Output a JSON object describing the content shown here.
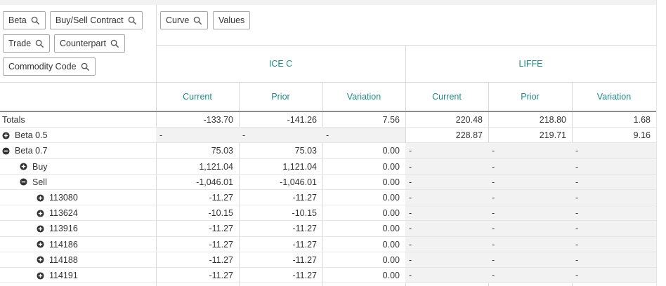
{
  "dimension_pills": [
    {
      "label": "Beta",
      "icon": "search-icon"
    },
    {
      "label": "Buy/Sell Contract",
      "icon": "search-icon"
    },
    {
      "label": "Trade",
      "icon": "search-icon"
    },
    {
      "label": "Counterpart",
      "icon": "search-icon"
    },
    {
      "label": "Commodity Code",
      "icon": "search-icon"
    }
  ],
  "column_pills": [
    {
      "label": "Curve",
      "icon": "search-icon"
    },
    {
      "label": "Values",
      "icon": ""
    }
  ],
  "groups": [
    {
      "label": "ICE C",
      "columns": [
        "Current",
        "Prior",
        "Variation"
      ]
    },
    {
      "label": "LIFFE",
      "columns": [
        "Current",
        "Prior",
        "Variation"
      ]
    }
  ],
  "colors": {
    "header_text": "#1d8a84",
    "border": "#d9d9d9",
    "null_cell": "#f2f2f2"
  },
  "rows": [
    {
      "label": "Totals",
      "level": 0,
      "toggle": "none",
      "ice": [
        "-133.70",
        "-141.26",
        "7.56"
      ],
      "liffe": [
        "220.48",
        "218.80",
        "1.68"
      ]
    },
    {
      "label": "Beta 0.5",
      "level": 0,
      "toggle": "plus-icon",
      "ice": [
        "-",
        "-",
        "-"
      ],
      "liffe": [
        "228.87",
        "219.71",
        "9.16"
      ]
    },
    {
      "label": "Beta 0.7",
      "level": 0,
      "toggle": "minus-icon",
      "ice": [
        "75.03",
        "75.03",
        "0.00"
      ],
      "liffe": [
        "-",
        "-",
        "-"
      ]
    },
    {
      "label": "Buy",
      "level": 1,
      "toggle": "plus-icon",
      "ice": [
        "1,121.04",
        "1,121.04",
        "0.00"
      ],
      "liffe": [
        "-",
        "-",
        "-"
      ]
    },
    {
      "label": "Sell",
      "level": 1,
      "toggle": "minus-icon",
      "ice": [
        "-1,046.01",
        "-1,046.01",
        "0.00"
      ],
      "liffe": [
        "-",
        "-",
        "-"
      ]
    },
    {
      "label": "113080",
      "level": 2,
      "toggle": "plus-icon",
      "ice": [
        "-11.27",
        "-11.27",
        "0.00"
      ],
      "liffe": [
        "-",
        "-",
        "-"
      ]
    },
    {
      "label": "113624",
      "level": 2,
      "toggle": "plus-icon",
      "ice": [
        "-10.15",
        "-10.15",
        "0.00"
      ],
      "liffe": [
        "-",
        "-",
        "-"
      ]
    },
    {
      "label": "113916",
      "level": 2,
      "toggle": "plus-icon",
      "ice": [
        "-11.27",
        "-11.27",
        "0.00"
      ],
      "liffe": [
        "-",
        "-",
        "-"
      ]
    },
    {
      "label": "114186",
      "level": 2,
      "toggle": "plus-icon",
      "ice": [
        "-11.27",
        "-11.27",
        "0.00"
      ],
      "liffe": [
        "-",
        "-",
        "-"
      ]
    },
    {
      "label": "114188",
      "level": 2,
      "toggle": "plus-icon",
      "ice": [
        "-11.27",
        "-11.27",
        "0.00"
      ],
      "liffe": [
        "-",
        "-",
        "-"
      ]
    },
    {
      "label": "114191",
      "level": 2,
      "toggle": "plus-icon",
      "ice": [
        "-11.27",
        "-11.27",
        "0.00"
      ],
      "liffe": [
        "-",
        "-",
        "-"
      ]
    }
  ]
}
